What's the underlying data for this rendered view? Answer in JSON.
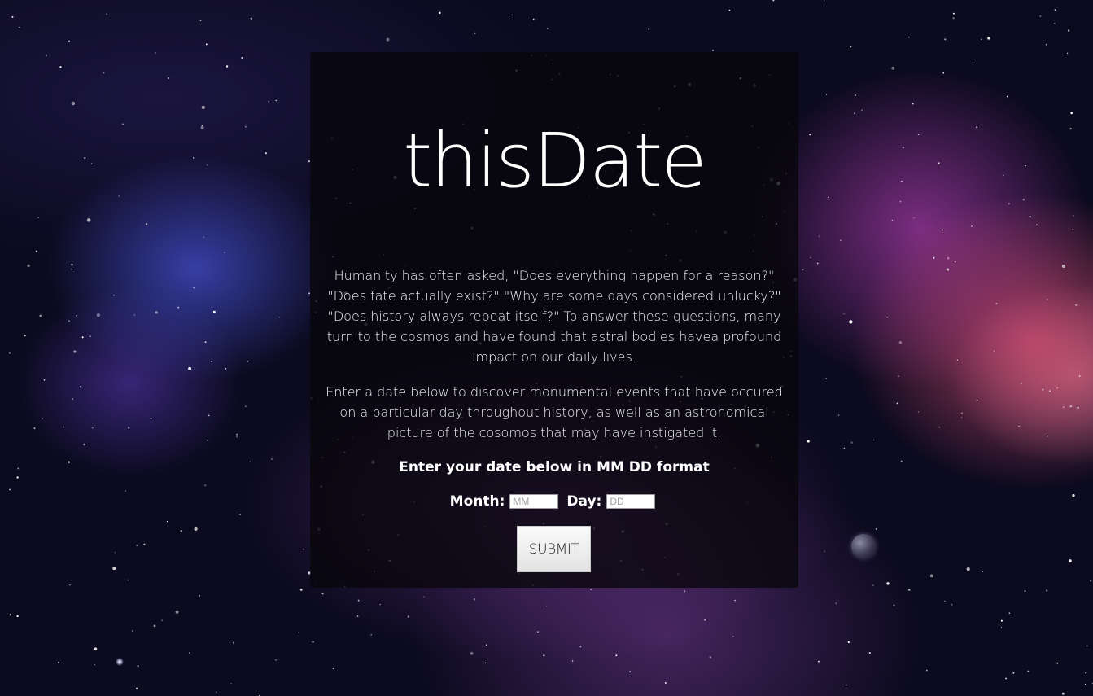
{
  "page": {
    "logo_text": "thisDate",
    "intro_paragraph": "Humanity has often asked, \"Does everything happen for a reason?\" \"Does fate actually exist?\" \"Why are some days considered unlucky?\" \"Does history always repeat itself?\" To answer these questions, many turn to the cosmos and have found that astral bodies havea profound impact on our daily lives.",
    "instruction_paragraph": "Enter a date below to discover monumental events that have occured on a particular day throughout history, as well as an astronomical picture of the cosomos that may have instigated it.",
    "prompt": "Enter your date below in MM DD format"
  },
  "form": {
    "month_label": "Month:",
    "month_placeholder": "MM",
    "month_value": "",
    "day_label": "Day:",
    "day_placeholder": "DD",
    "day_value": "",
    "submit_label": "SUBMIT"
  },
  "colors": {
    "panel_background": "#08060c",
    "text": "#ffffff",
    "button_background": "#ececec"
  }
}
